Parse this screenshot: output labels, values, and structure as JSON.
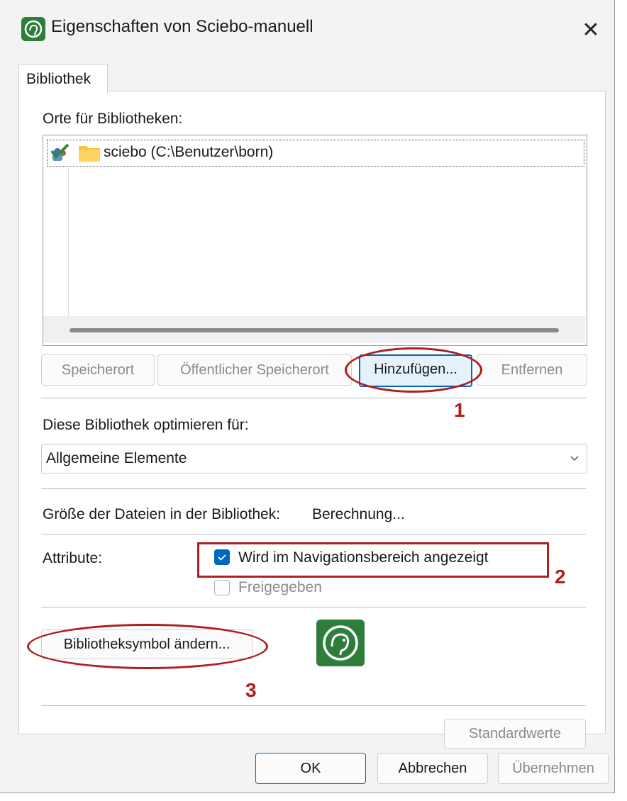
{
  "window": {
    "title": "Eigenschaften von Sciebo-manuell",
    "close_symbol": "✕"
  },
  "tabs": [
    {
      "label": "Bibliothek"
    }
  ],
  "locations": {
    "heading": "Orte für Bibliotheken:",
    "items": [
      {
        "label": "sciebo (C:\\Benutzer\\born)"
      }
    ]
  },
  "location_buttons": {
    "speicherort": "Speicherort",
    "public": "Öffentlicher Speicherort",
    "add": "Hinzufügen...",
    "remove": "Entfernen"
  },
  "optimize": {
    "heading": "Diese Bibliothek optimieren für:",
    "selected": "Allgemeine Elemente"
  },
  "size": {
    "label": "Größe der Dateien in der Bibliothek:",
    "value": "Berechnung..."
  },
  "attributes": {
    "label": "Attribute:",
    "nav_label": "Wird im Navigationsbereich angezeigt",
    "nav_checked": true,
    "shared_label": "Freigegeben",
    "shared_checked": false
  },
  "icon_section": {
    "change_button": "Bibliotheksymbol ändern..."
  },
  "defaults_button": "Standardwerte",
  "footer": {
    "ok": "OK",
    "cancel": "Abbrechen",
    "apply": "Übernehmen"
  },
  "annotations": {
    "one": "1",
    "two": "2",
    "three": "3"
  },
  "colors": {
    "accent": "#0067c0",
    "annotation_red": "#b01e1e",
    "sciebo_green": "#2e7d3a"
  }
}
